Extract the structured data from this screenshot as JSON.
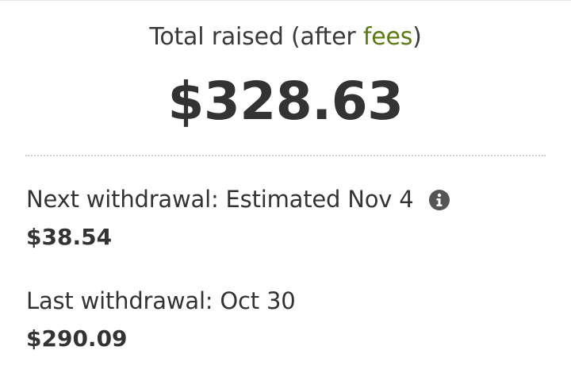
{
  "summary": {
    "total_label_prefix": "Total raised (after ",
    "total_label_link": "fees",
    "total_label_suffix": ")",
    "total_amount": "$328.63"
  },
  "withdrawals": {
    "next": {
      "label": "Next withdrawal: Estimated Nov 4",
      "amount": "$38.54",
      "info_icon": "info-circle"
    },
    "last": {
      "label": "Last withdrawal: Oct 30",
      "amount": "$290.09"
    }
  },
  "colors": {
    "link": "#5a7a12",
    "text": "#333333",
    "icon": "#555555",
    "divider": "#cfcfcf"
  }
}
